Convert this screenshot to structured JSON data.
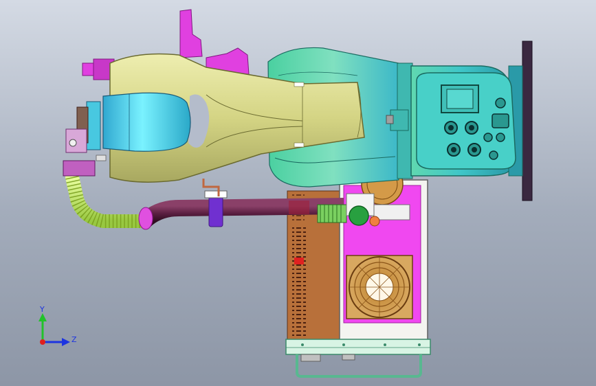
{
  "viewport": {
    "background_top": "#d4dae4",
    "background_bottom": "#8d96a6"
  },
  "triad": {
    "y_label": "Y",
    "z_label": "Z",
    "y_color": "#22c22a",
    "z_color": "#1d34e0",
    "x_color": "#e0201d"
  },
  "colors": {
    "base_plate": "#3a2840",
    "teal": "#3fc6c0",
    "arm_olive": "#d8d88c",
    "arm_cyan": "#4ee0f0",
    "magenta": "#e040e0",
    "hose_green": "#c8f060",
    "cable_dark": "#5a2040",
    "cabinet_brown": "#b8703a",
    "cabinet_pink": "#f048f0",
    "frame_green": "#58b890",
    "fan_orange": "#d09a4a"
  }
}
